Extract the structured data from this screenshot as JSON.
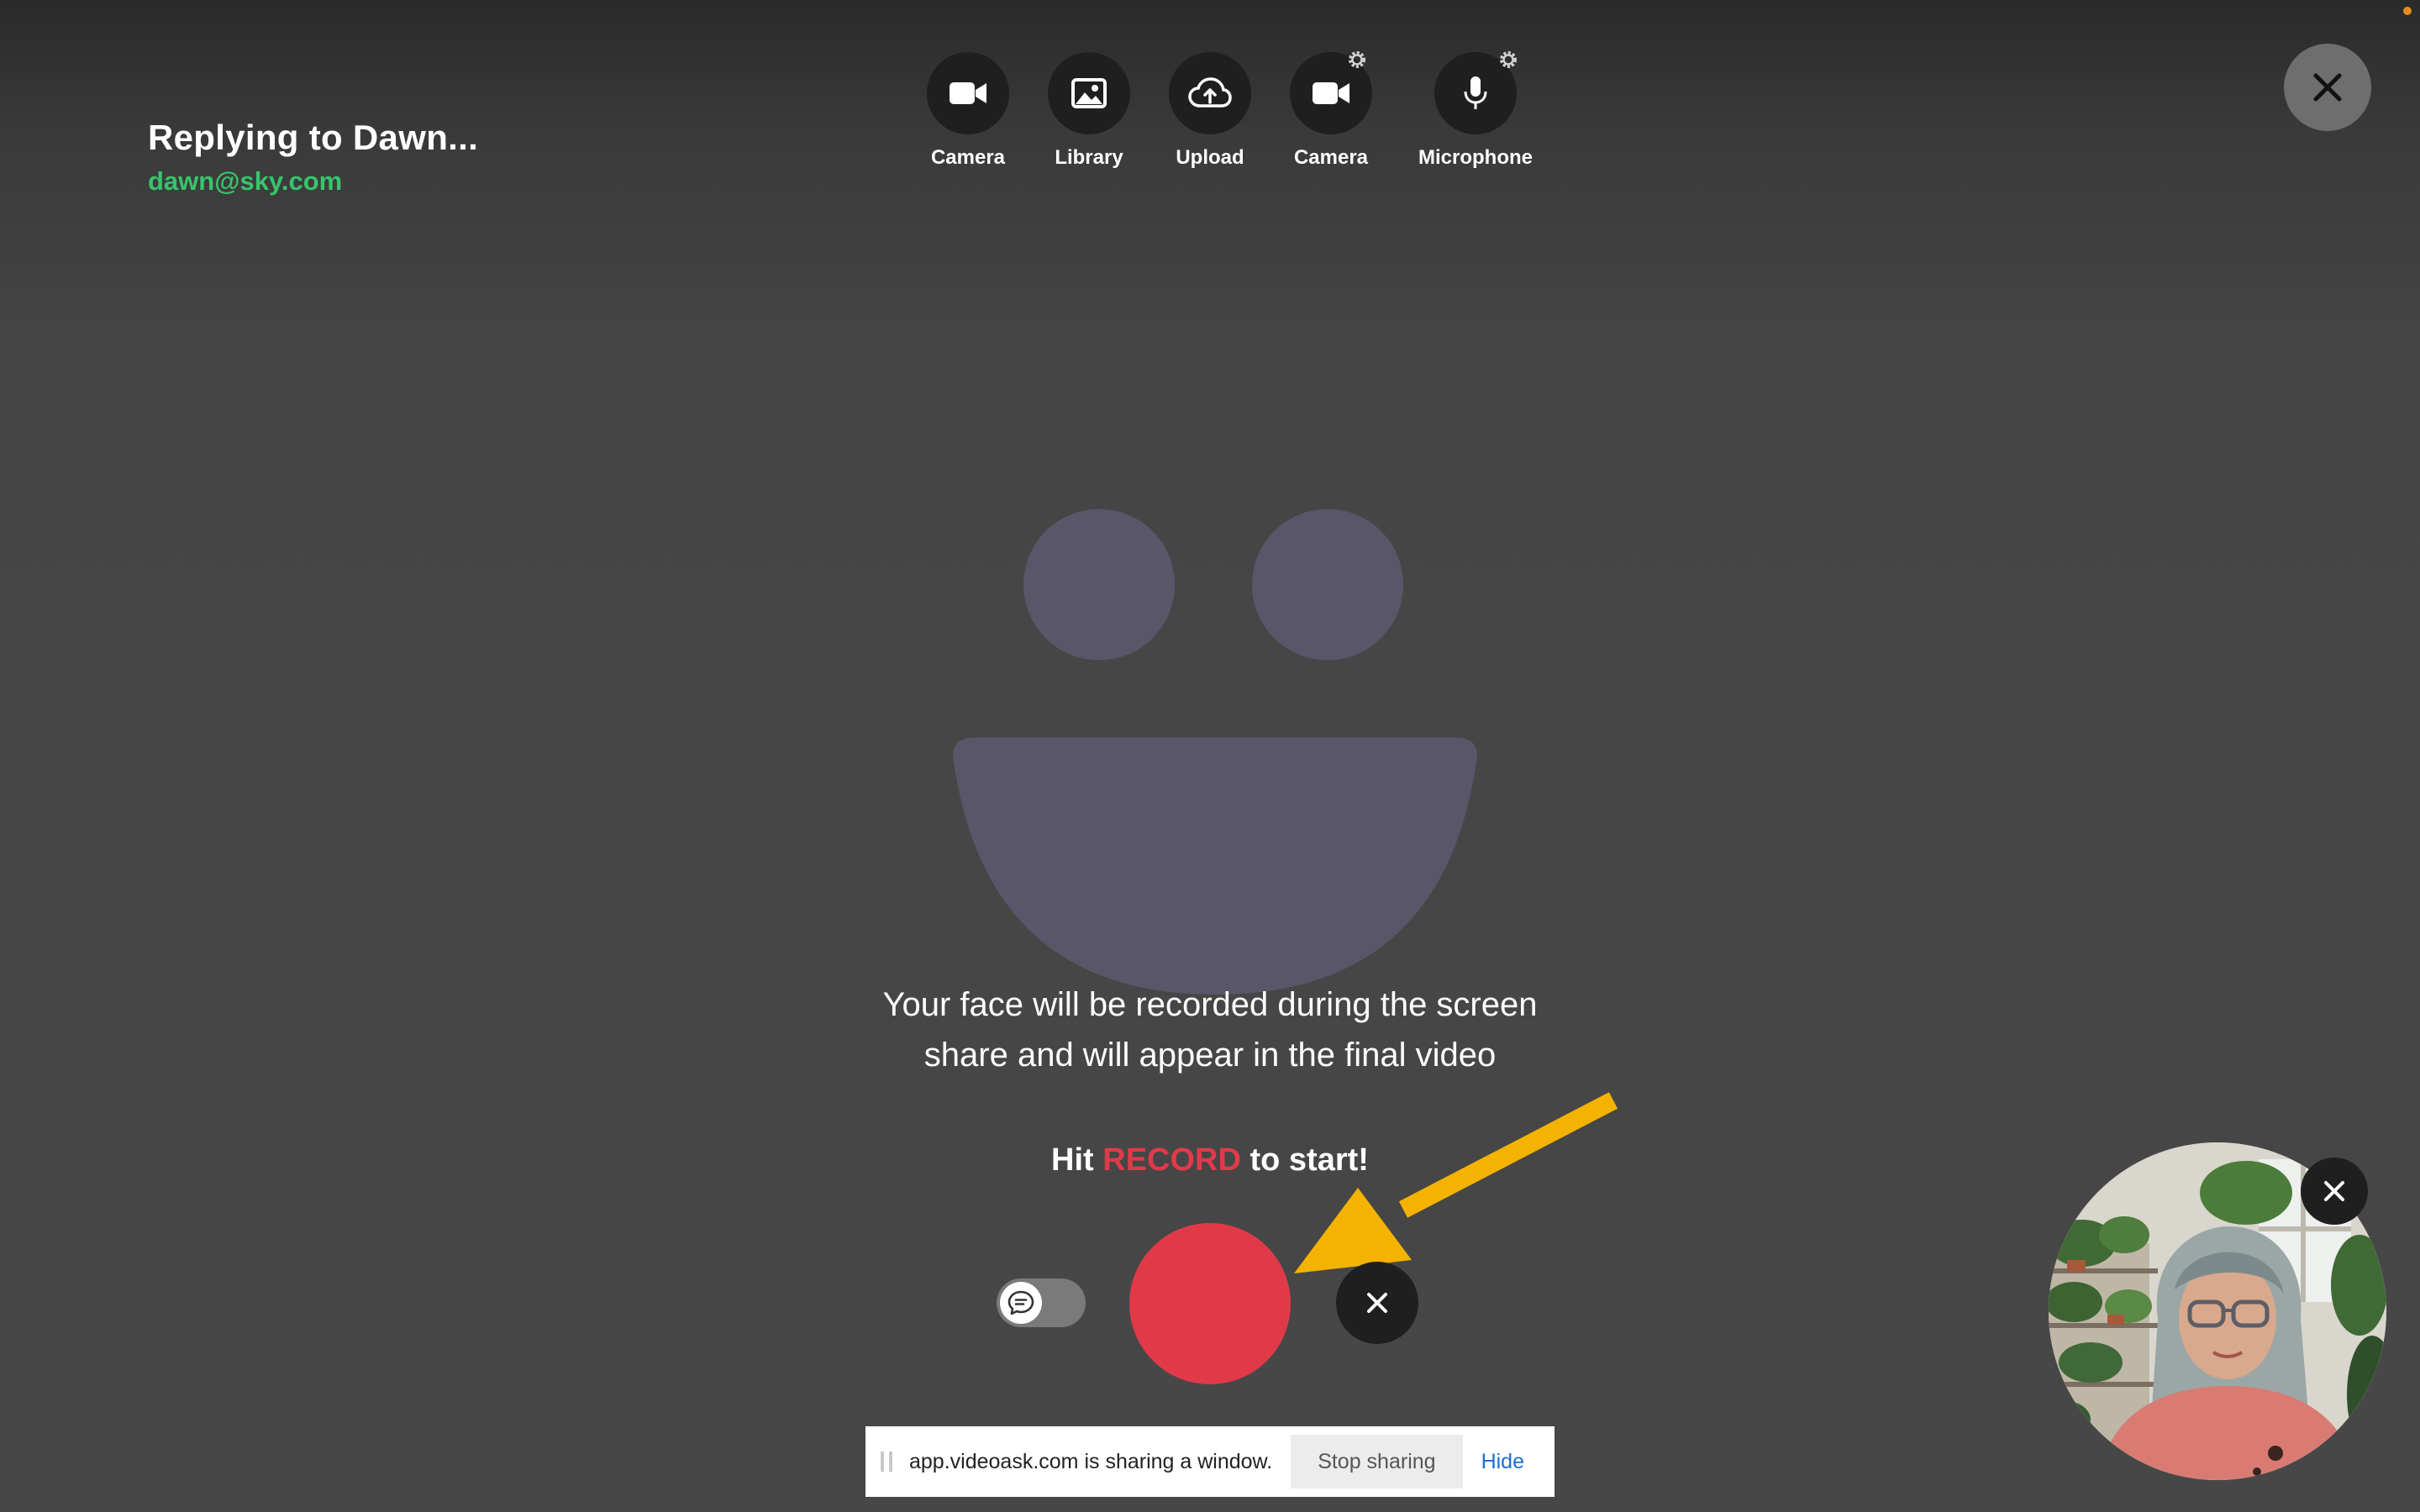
{
  "header": {
    "title": "Replying to Dawn...",
    "email": "dawn@sky.com"
  },
  "toolbar": {
    "items": [
      {
        "label": "Camera",
        "icon": "video-camera-icon"
      },
      {
        "label": "Library",
        "icon": "image-icon"
      },
      {
        "label": "Upload",
        "icon": "cloud-upload-icon"
      },
      {
        "label": "Camera",
        "icon": "video-camera-icon",
        "settings": true
      },
      {
        "label": "Microphone",
        "icon": "microphone-icon",
        "settings": true
      }
    ]
  },
  "main": {
    "info_line1": "Your face will be recorded during the screen",
    "info_line2": "share and will appear in the final video",
    "hit_prefix": "Hit",
    "hit_accent": "RECORD",
    "hit_suffix": "to start!"
  },
  "share_bar": {
    "message": "app.videoask.com is sharing a window.",
    "stop_label": "Stop sharing",
    "hide_label": "Hide"
  },
  "colors": {
    "accent_green": "#37c46b",
    "record_red": "#e03a48",
    "arrow_yellow": "#f5b301",
    "placeholder_face": "#5a5669"
  }
}
